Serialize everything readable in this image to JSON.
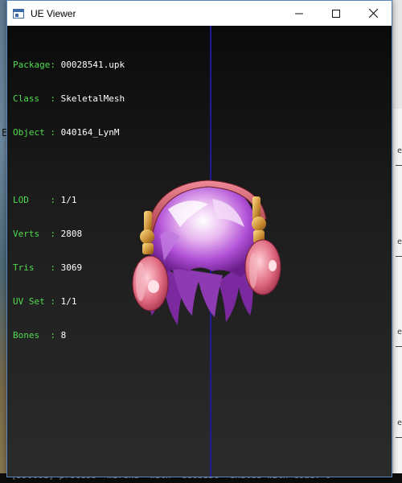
{
  "window": {
    "title": "UE Viewer",
    "icon": "app-window-icon"
  },
  "caption_buttons": {
    "minimize_icon": "minimize-icon",
    "maximize_icon": "maximize-icon",
    "close_icon": "close-icon"
  },
  "info": {
    "package": {
      "key": "Package: ",
      "value": "00028541.upk"
    },
    "class": {
      "key": "Class  : ",
      "value": "SkeletalMesh"
    },
    "object": {
      "key": "Object : ",
      "value": "040164_LynM"
    },
    "lod": {
      "key": "LOD    : ",
      "value": "1/1"
    },
    "verts": {
      "key": "Verts  : ",
      "value": "2808"
    },
    "tris": {
      "key": "Tris   : ",
      "value": "3069"
    },
    "uvset": {
      "key": "UV Set : ",
      "value": "1/1"
    },
    "bones": {
      "key": "Bones  : ",
      "value": "8"
    }
  },
  "background": {
    "console_text": "[D50001] process 'mircha' with 'deobize' exited with code: 0",
    "left_glyph": "E",
    "right_marks": [
      "e",
      "e",
      "e",
      "e"
    ]
  },
  "colors": {
    "key_text": "#4fdc4f",
    "value_text": "#ffffff",
    "axis_line": "#1c1c9a",
    "hair": "#b04fd6",
    "headphone": "#e07a8a",
    "metal": "#d6a040"
  }
}
